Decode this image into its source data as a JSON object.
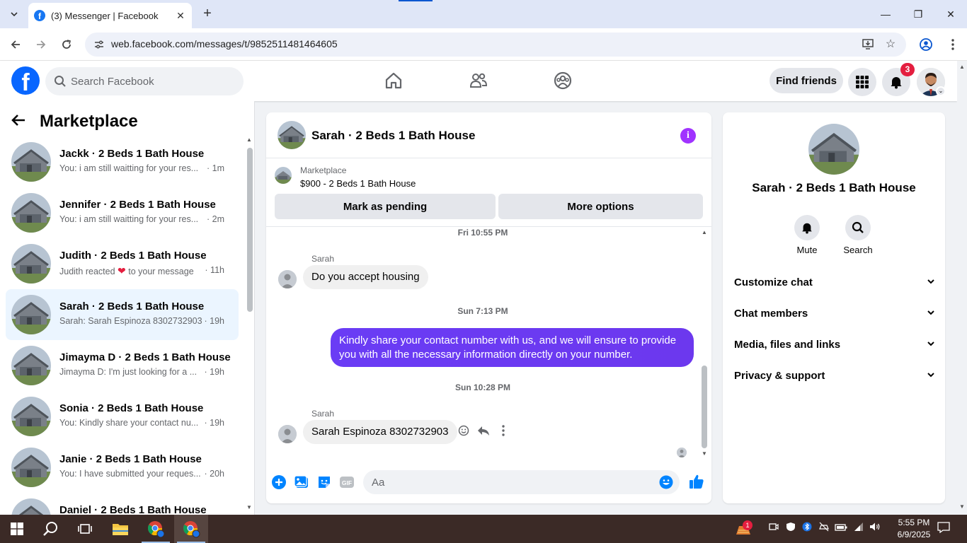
{
  "browser": {
    "tab_title": "(3) Messenger | Facebook",
    "url": "web.facebook.com/messages/t/9852511481464605"
  },
  "header": {
    "search_placeholder": "Search Facebook",
    "find_friends": "Find friends",
    "notifications_count": "3",
    "brand_color": "#0866ff"
  },
  "sidebar": {
    "title": "Marketplace",
    "conversations": [
      {
        "name": "Jackk · 2 Beds 1 Bath House",
        "preview": "You: i am still waitting for your res...",
        "time": "· 1m",
        "active": false
      },
      {
        "name": "Jennifer · 2 Beds 1 Bath House",
        "preview": "You: i am still waitting for your res...",
        "time": "· 2m",
        "active": false
      },
      {
        "name": "Judith · 2 Beds 1 Bath House",
        "preview": "Judith reacted",
        "preview_tail": "to your message",
        "time": "· 11h",
        "active": false
      },
      {
        "name": "Sarah · 2 Beds 1 Bath House",
        "preview": "Sarah: Sarah Espinoza 8302732903",
        "time": "· 19h",
        "active": true
      },
      {
        "name": "Jimayma D · 2 Beds 1 Bath House",
        "preview": "Jimayma D: I'm just looking for a ...",
        "time": "· 19h",
        "active": false
      },
      {
        "name": "Sonia · 2 Beds 1 Bath House",
        "preview": "You: Kindly share your contact nu...",
        "time": "· 19h",
        "active": false
      },
      {
        "name": "Janie · 2 Beds 1 Bath House",
        "preview": "You: I have submitted your reques...",
        "time": "· 20h",
        "active": false
      },
      {
        "name": "Daniel · 2 Beds 1 Bath House",
        "preview": "",
        "time": "",
        "active": false
      }
    ]
  },
  "chat": {
    "title": "Sarah · 2 Beds 1 Bath House",
    "listing_label": "Marketplace",
    "listing_price": "$900 - 2 Beds 1 Bath House",
    "mark_pending": "Mark as pending",
    "more_options": "More options",
    "messages": [
      {
        "type": "timestamp",
        "text": "Fri 10:55 PM"
      },
      {
        "type": "incoming",
        "sender": "Sarah",
        "text": "Do you accept housing"
      },
      {
        "type": "timestamp",
        "text": "Sun 7:13 PM"
      },
      {
        "type": "outgoing",
        "text": "Kindly share your contact number with us, and we will ensure to provide you with all the necessary information directly on your number."
      },
      {
        "type": "timestamp",
        "text": "Sun 10:28 PM"
      },
      {
        "type": "incoming",
        "sender": "Sarah",
        "text": "Sarah Espinoza 8302732903"
      }
    ],
    "composer_placeholder": "Aa",
    "accent_color": "#0084ff",
    "outgoing_color": "#6a3cf5"
  },
  "info_panel": {
    "name": "Sarah · 2 Beds 1 Bath House",
    "mute_label": "Mute",
    "search_label": "Search",
    "sections": [
      "Customize chat",
      "Chat members",
      "Media, files and links",
      "Privacy & support"
    ]
  },
  "taskbar": {
    "time": "5:55 PM",
    "date": "6/9/2025",
    "tray_badge": "1",
    "background": "#3b2a26"
  }
}
